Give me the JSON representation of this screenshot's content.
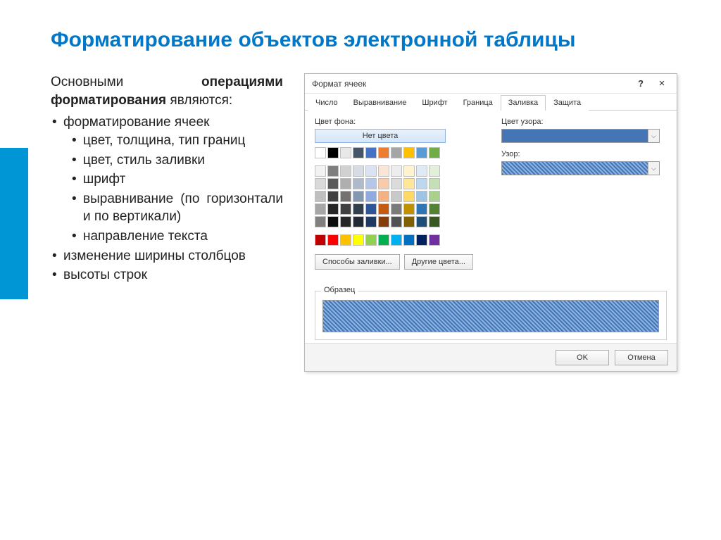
{
  "slide": {
    "title": "Форматирование объектов электронной таблицы",
    "intro_prefix": "Основными ",
    "intro_bold": "операциями форматирования",
    "intro_suffix": " являются:",
    "bullets": [
      "форматирование ячеек",
      "изменение ширины столбцов",
      "высоты строк"
    ],
    "subbullets": [
      "цвет, толщина, тип границ",
      "цвет, стиль заливки",
      "шрифт",
      "выравнивание (по горизонтали и по вертикали)",
      "направление текста"
    ]
  },
  "dialog": {
    "title": "Формат ячеек",
    "tabs": [
      "Число",
      "Выравнивание",
      "Шрифт",
      "Граница",
      "Заливка",
      "Защита"
    ],
    "active_tab_index": 4,
    "bg_label": "Цвет фона:",
    "no_color": "Нет цвета",
    "pattern_color_label": "Цвет узора:",
    "pattern_label": "Узор:",
    "fill_methods": "Способы заливки...",
    "other_colors": "Другие цвета...",
    "sample_label": "Образец",
    "ok": "OK",
    "cancel": "Отмена"
  },
  "palette": {
    "theme_row": [
      "#ffffff",
      "#000000",
      "#e8e8e8",
      "#445568",
      "#4473c5",
      "#ed7d31",
      "#a5a5a5",
      "#ffc000",
      "#5b9bd5",
      "#70ad47"
    ],
    "shade_rows": [
      [
        "#f2f2f2",
        "#7f7f7f",
        "#d1d1d1",
        "#d7dce4",
        "#dae3f3",
        "#fbe5d6",
        "#ededed",
        "#fff2cc",
        "#deebf7",
        "#e2f0d9"
      ],
      [
        "#d9d9d9",
        "#595959",
        "#afafaf",
        "#aeb9ca",
        "#b4c7e7",
        "#f8cbad",
        "#dbdbdb",
        "#ffe699",
        "#bdd7ee",
        "#c5e0b4"
      ],
      [
        "#bfbfbf",
        "#404040",
        "#767171",
        "#8497b0",
        "#8faadc",
        "#f4b183",
        "#c9c9c9",
        "#ffd966",
        "#9dc3e6",
        "#a9d18e"
      ],
      [
        "#a6a6a6",
        "#262626",
        "#404040",
        "#323f4f",
        "#2e5597",
        "#c55a11",
        "#7b7b7b",
        "#bf9000",
        "#2e75b6",
        "#548235"
      ],
      [
        "#808080",
        "#0d0d0d",
        "#262626",
        "#222a35",
        "#203864",
        "#843c0c",
        "#525252",
        "#806000",
        "#1f4e79",
        "#385723"
      ]
    ],
    "standard_row": [
      "#c00000",
      "#ff0000",
      "#ffc000",
      "#ffff00",
      "#92d050",
      "#00b050",
      "#00b0f0",
      "#0070c0",
      "#002060",
      "#7030a0"
    ]
  }
}
